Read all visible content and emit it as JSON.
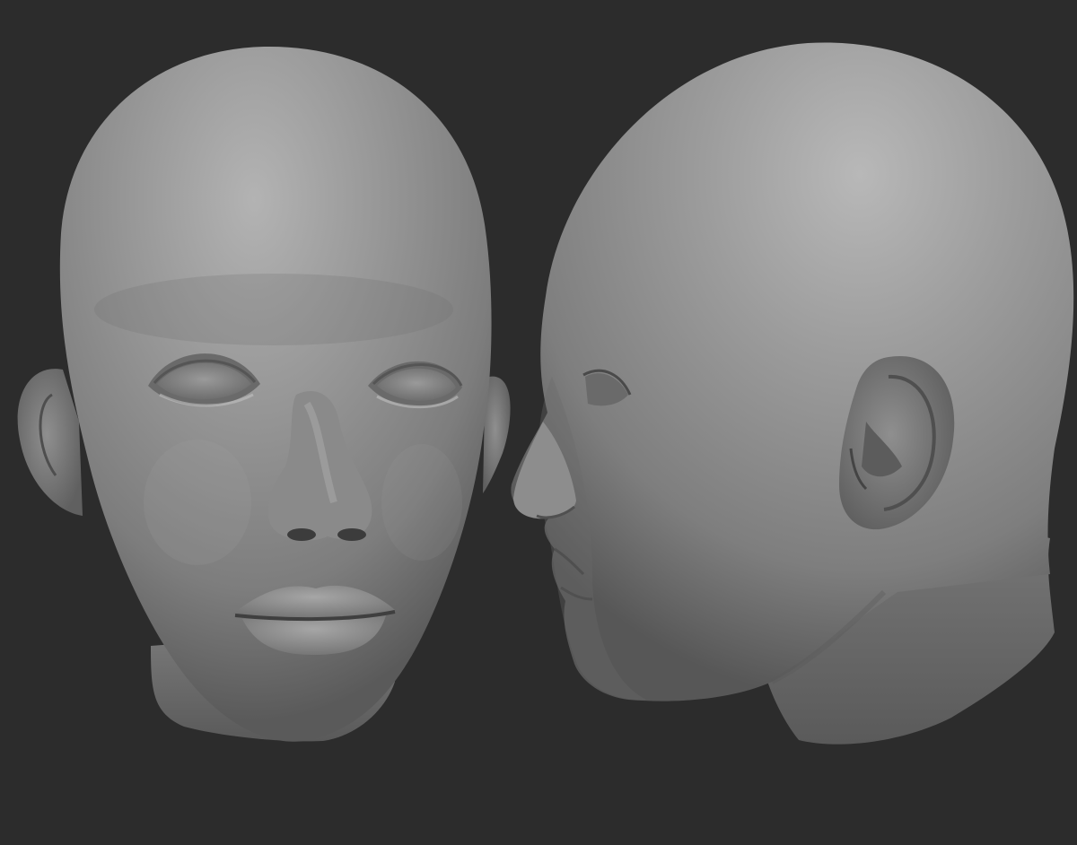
{
  "scene": {
    "background_color": "#2c2c2c",
    "material_color": "#8c8c8c",
    "views": [
      {
        "name": "front-view",
        "subject": "head-sculpt-front"
      },
      {
        "name": "side-view",
        "subject": "head-sculpt-side"
      }
    ]
  }
}
